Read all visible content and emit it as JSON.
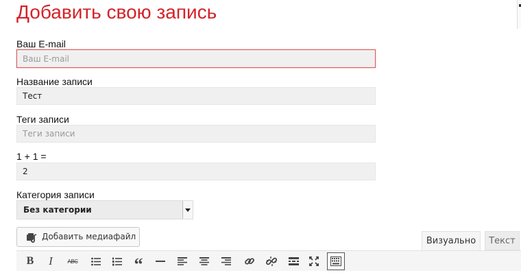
{
  "page": {
    "title": "Добавить свою запись"
  },
  "form": {
    "email": {
      "label": "Ваш E-mail",
      "placeholder": "Ваш E-mail",
      "value": ""
    },
    "post_title": {
      "label": "Название записи",
      "placeholder": "",
      "value": "Тест"
    },
    "tags": {
      "label": "Теги записи",
      "placeholder": "Теги записи",
      "value": ""
    },
    "captcha": {
      "label": "1 + 1 =",
      "placeholder": "",
      "value": "2"
    },
    "category": {
      "label": "Категория записи",
      "selected": "Без категории"
    }
  },
  "editor": {
    "add_media_label": "Добавить медиафайл",
    "tabs": {
      "visual": "Визуально",
      "text": "Текст"
    },
    "toolbar": {
      "bold": "B",
      "italic": "I",
      "strike": "ABC",
      "blockquote": "“"
    }
  },
  "colors": {
    "title": "#d3232a",
    "error_border": "#e05a5a",
    "field_bg": "#f0f0f0"
  },
  "icons": [
    "add-media-icon",
    "bold-icon",
    "italic-icon",
    "strikethrough-icon",
    "bullet-list-icon",
    "numbered-list-icon",
    "blockquote-icon",
    "horizontal-line-icon",
    "align-left-icon",
    "align-center-icon",
    "align-right-icon",
    "link-icon",
    "unlink-icon",
    "read-more-icon",
    "fullscreen-icon",
    "toolbar-toggle-icon"
  ]
}
